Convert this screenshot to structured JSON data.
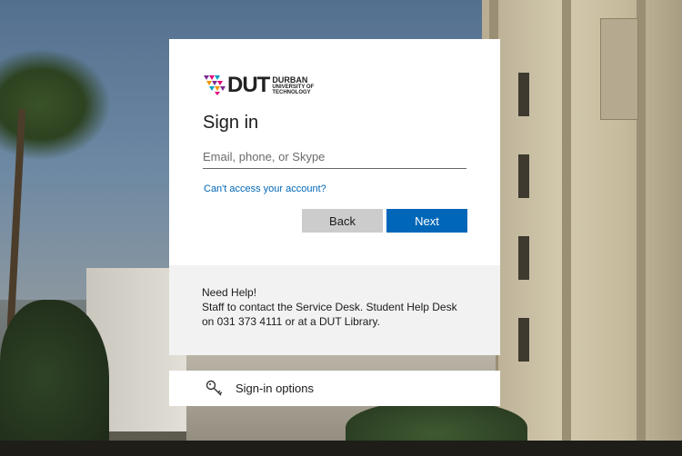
{
  "logo": {
    "mark": "DUT",
    "line1": "DURBAN",
    "line2": "UNIVERSITY OF",
    "line3": "TECHNOLOGY"
  },
  "signin": {
    "title": "Sign in",
    "email_placeholder": "Email, phone, or Skype",
    "email_value": "",
    "cant_access_link": "Can't access your account?",
    "back_label": "Back",
    "next_label": "Next"
  },
  "help": {
    "heading": "Need Help!",
    "line1": "Staff to contact the Service Desk. Student Help Desk",
    "line2": "on 031 373 4111 or at a DUT Library."
  },
  "signin_options": {
    "label": "Sign-in options",
    "icon": "key-icon"
  },
  "colors": {
    "accent": "#0067b8",
    "back_button": "#cccccc",
    "help_background": "#f2f2f2"
  }
}
